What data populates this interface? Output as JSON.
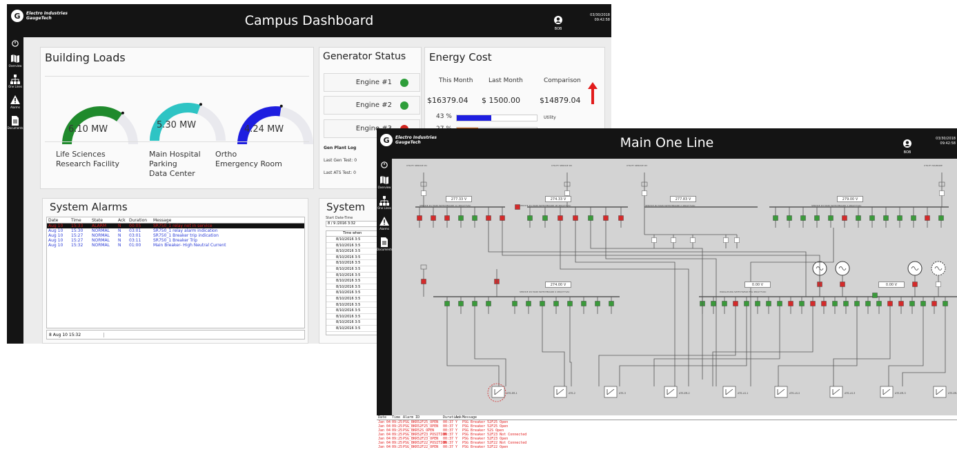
{
  "dashboard": {
    "logo_mark": "G",
    "logo_text_1": "Electro Industries",
    "logo_text_2": "GaugeTech",
    "title": "Campus Dashboard",
    "user": "BOB",
    "date": "03/30/2018",
    "time": "09:42:58",
    "nav": [
      {
        "label": "Overview",
        "icon": "map-icon"
      },
      {
        "label": "One Lines",
        "icon": "hierarchy-icon"
      },
      {
        "label": "Alarms",
        "icon": "warning-icon"
      },
      {
        "label": "Documents",
        "icon": "document-icon"
      }
    ],
    "building_loads": {
      "title": "Building Loads",
      "gauges": [
        {
          "value": "6.10 MW",
          "level": 0.7,
          "color": "#1f8a2c"
        },
        {
          "value": "5.30 MW",
          "level": 0.61,
          "color": "#2ec4c4"
        },
        {
          "value": "4.24 MW",
          "level": 0.55,
          "color": "#1e1ee0"
        }
      ],
      "facilities": [
        {
          "line1": "Life Sciences",
          "line2": "Research Facility",
          "line3": ""
        },
        {
          "line1": "Main Hospital",
          "line2": "Parking",
          "line3": "Data Center"
        },
        {
          "line1": "Ortho",
          "line2": "Emergency Room",
          "line3": ""
        }
      ]
    },
    "generator_status": {
      "title": "Generator Status",
      "engines": [
        {
          "label": "Engine #1",
          "color": "#2e9e3a"
        },
        {
          "label": "Engine #2",
          "color": "#2e9e3a"
        },
        {
          "label": "Engine #3",
          "color": "#d0241e"
        }
      ],
      "log_title": "Gen Plant Log",
      "log_lines": [
        "Last Gen Test: 0",
        "Last ATS Test: 0"
      ]
    },
    "energy_cost": {
      "title": "Energy Cost",
      "headers": [
        "This Month",
        "Last Month",
        "Comparison"
      ],
      "values": [
        "$16379.04",
        "$ 1500.00",
        "$14879.04"
      ],
      "arrow_color": "#e21b1b",
      "bars": [
        {
          "pct": "43 %",
          "fill": 0.43,
          "color": "#1e1ee0",
          "label": "Utility"
        },
        {
          "pct": "27 %",
          "fill": 0.27,
          "color": "#f07820",
          "label": ""
        }
      ]
    },
    "system_alarms": {
      "title": "System Alarms",
      "columns": [
        "Date",
        "Time",
        "State",
        "Ack",
        "Duration",
        "Message"
      ],
      "rows": [
        {
          "date": "Aug 10",
          "time": "15:33",
          "state": "ALARM",
          "ack": "N",
          "dur": "00:05",
          "msg": "SR750_1 relay not in service",
          "active": true
        },
        {
          "date": "Aug 10",
          "time": "15:30",
          "state": "NORMAL",
          "ack": "N",
          "dur": "03:01",
          "msg": "SR750_1 relay alarm indication",
          "active": false
        },
        {
          "date": "Aug 10",
          "time": "15:27",
          "state": "NORMAL",
          "ack": "N",
          "dur": "03:01",
          "msg": "SR750_1 Breaker trip indication",
          "active": false
        },
        {
          "date": "Aug 10",
          "time": "15:27",
          "state": "NORMAL",
          "ack": "N",
          "dur": "03:11",
          "msg": "SR750_1 Breaker Trip",
          "active": false
        },
        {
          "date": "Aug 10",
          "time": "15:32",
          "state": "NORMAL",
          "ack": "N",
          "dur": "01:00",
          "msg": "Main Breaker- High Neutral Current",
          "active": false
        }
      ],
      "footer": "8 Aug 10 15:32"
    },
    "system_events": {
      "title": "System",
      "start_label": "Start Date-Time",
      "start_value": "8 / 9 /2016 3:32",
      "col": "Time when",
      "rows": [
        "8/10/2016 3:5",
        "8/10/2016 3:5",
        "8/10/2016 3:5",
        "8/10/2016 3:5",
        "8/10/2016 3:5",
        "8/10/2016 3:5",
        "8/10/2016 3:5",
        "8/10/2016 3:5",
        "8/10/2016 3:5",
        "8/10/2016 3:5",
        "8/10/2016 3:5",
        "8/10/2016 3:5",
        "8/10/2016 3:5",
        "8/10/2016 3:5",
        "8/10/2016 3:5",
        "8/10/2016 3:5"
      ]
    }
  },
  "oneline": {
    "logo_mark": "G",
    "logo_text_1": "Electro Industries",
    "logo_text_2": "GaugeTech",
    "title": "Main One Line",
    "user": "BOB",
    "date": "03/30/2018",
    "time": "09:42:58",
    "nav": [
      {
        "label": "Overview",
        "icon": "map-icon"
      },
      {
        "label": "One Lines",
        "icon": "hierarchy-icon"
      },
      {
        "label": "Alarms",
        "icon": "warning-icon"
      },
      {
        "label": "Documents",
        "icon": "document-icon"
      }
    ],
    "services": [
      "UTILITY SERVICE #1",
      "UTILITY SERVICE #2",
      "UTILITY SERVICE #3",
      "UTILITY MAINSIDE"
    ],
    "voltages": [
      "277.33 V",
      "274.33 V",
      "277.83 V",
      "279.00 V",
      "274.00 V",
      "0.00 V",
      "0.00 V"
    ],
    "bus_labels": [
      "SERVICE #1 MAIN SWITCHBOARD 1A 480/277VAC",
      "SERVICE #1 MAIN SWITCHBOARD 1B 480/277VAC",
      "SERVICE #2 MAIN SWITCHBOARD 2 480/277VAC",
      "SERVICE #3 MAIN SWITCHBOARD 3 480/277VAC",
      "SERVICE #4 MAIN SWITCHBOARD 4 480/277VAC",
      "PARALLELING SWITCHGEAR PSG 480/277VAC"
    ],
    "ats_labels": [
      "ATS-ER-1",
      "ATS-2",
      "ATS-3",
      "ATS-ER-2",
      "ATS-LS-1",
      "ATS-LS-2",
      "ATS-LS-3",
      "ATS-ER-3",
      "ATS-ER-4"
    ],
    "alarm_columns": [
      "Date",
      "Time",
      "Alarm ID",
      "Duration",
      "Ack",
      "Message"
    ],
    "alarm_rows": [
      {
        "date": "Jan 04",
        "time": "09:25",
        "id": "PSG_BKR52F25_OPEN",
        "dur": "00:37",
        "ack": "Y",
        "msg": "PSG Breaker 52F25 Open"
      },
      {
        "date": "Jan 04",
        "time": "09:25",
        "id": "PSG_BKR52F25_OPEN",
        "dur": "00:37",
        "ack": "Y",
        "msg": "PSG Breaker 52F25 Open"
      },
      {
        "date": "Jan 04",
        "time": "09:25",
        "id": "PSG_BKR52S_OPEN",
        "dur": "00:37",
        "ack": "Y",
        "msg": "PSG Breaker 52S Open"
      },
      {
        "date": "Jan 04",
        "time": "09:25",
        "id": "PSG_BKR52F23_POSITION",
        "dur": "00:37",
        "ack": "Y",
        "msg": "PSG Breaker 52F23 Not Connected"
      },
      {
        "date": "Jan 04",
        "time": "09:25",
        "id": "PSG_BKR52F23_OPEN",
        "dur": "00:37",
        "ack": "Y",
        "msg": "PSG Breaker 52F23 Open"
      },
      {
        "date": "Jan 04",
        "time": "09:25",
        "id": "PSG_BKR52F22_POSITION",
        "dur": "00:37",
        "ack": "Y",
        "msg": "PSG Breaker 52F22 Not Connected"
      },
      {
        "date": "Jan 04",
        "time": "09:25",
        "id": "PSG_BKR52F22_OPEN",
        "dur": "00:37",
        "ack": "Y",
        "msg": "PSG Breaker 52F22 Open"
      }
    ]
  }
}
